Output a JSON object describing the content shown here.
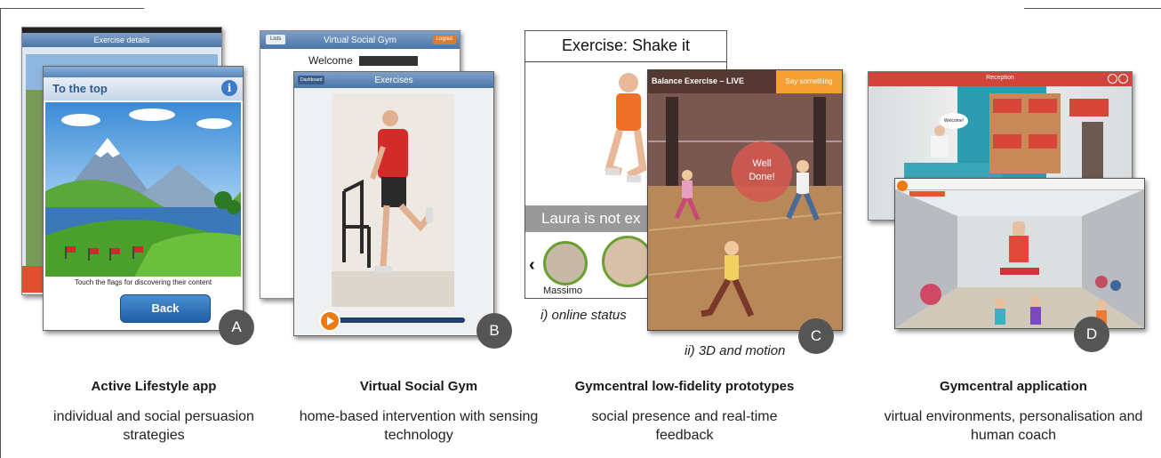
{
  "panels": [
    {
      "id": "A",
      "badge": "A",
      "screen_back_title": "Exercise details",
      "screen_front_title": "To the top",
      "screen_instruction": "Touch the flags for discovering their content",
      "back_button": "Back",
      "caption_title": "Active Lifestyle app",
      "caption_sub": "individual and social persuasion strategies"
    },
    {
      "id": "B",
      "badge": "B",
      "screen_back_title": "Virtual Social Gym",
      "screen_back_welcome": "Welcome",
      "screen_back_left_btn": "Lists",
      "screen_back_right_btn": "Logout",
      "screen_front_title": "Exercises",
      "screen_front_left_btn": "Dashboard",
      "caption_title": "Virtual Social Gym",
      "caption_sub": "home-based intervention with sensing technology"
    },
    {
      "id": "C",
      "badge": "C",
      "screen_back_title": "Exercise: Shake it",
      "screen_back_status": "Laura is not ex",
      "screen_back_user": "Massimo",
      "label_i": "i) online status",
      "screen_front_title": "Balance Exercise – LIVE",
      "screen_front_button": "Say something",
      "screen_front_bubble": "Well Done!",
      "label_ii": "ii) 3D and motion",
      "caption_title": "Gymcentral low-fidelity prototypes",
      "caption_sub": "social presence and real-time feedback"
    },
    {
      "id": "D",
      "badge": "D",
      "screen_back_title": "Reception",
      "screen_back_speech": "Welcome!",
      "caption_title": "Gymcentral application",
      "caption_sub": "virtual environments, personalisation and human coach"
    }
  ],
  "colors": {
    "ios_blue": "#4a74a8",
    "badge_gray": "#555555",
    "live_orange": "#f5a030",
    "reception_red": "#d0443a"
  }
}
